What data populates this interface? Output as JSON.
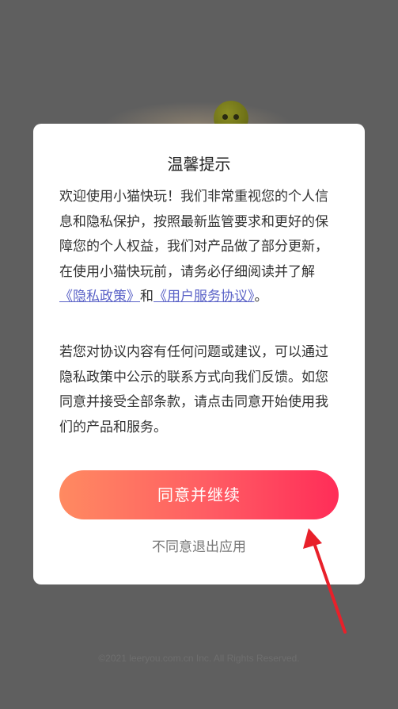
{
  "dialog": {
    "title": "温馨提示",
    "para1": {
      "text_before": "欢迎使用小猫快玩！我们非常重视您的个人信息和隐私保护，按照最新监管要求和更好的保障您的个人权益，我们对产品做了部分更新，在使用小猫快玩前，请务必仔细阅读并了解 ",
      "privacy_link": "《隐私政策》",
      "conjunction": "和",
      "service_link": "《用户服务协议》",
      "text_after": "。"
    },
    "para2": "若您对协议内容有任何问题或建议，可以通过隐私政策中公示的联系方式向我们反馈。如您同意并接受全部条款，请点击同意开始使用我们的产品和服务。",
    "agree_button": "同意并继续",
    "decline_link": "不同意退出应用"
  },
  "footer": {
    "copyright": "©2021 leeryou.com.cn Inc. All Rights Reserved."
  },
  "colors": {
    "overlay": "#5f5f5f",
    "link": "#5a62c7",
    "button_start": "#ff8a61",
    "button_end": "#ff2d58",
    "annotation_arrow": "#e8202a"
  },
  "icons": {
    "background_emoji": "smiley-face-icon",
    "annotation": "red-arrow-icon"
  }
}
